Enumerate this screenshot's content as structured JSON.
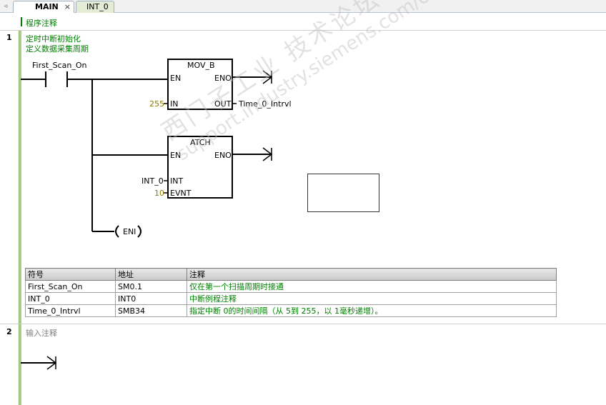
{
  "tabs": [
    {
      "label": "MAIN",
      "close": "×"
    },
    {
      "label": "INT_0"
    }
  ],
  "scroll_left_glyph": "◃",
  "program_comment": "程序注释",
  "network1": {
    "number": "1",
    "comment_line1": "定时中断初始化",
    "comment_line2": "定义数据采集周期",
    "contact_label": "First_Scan_On",
    "mov_b": {
      "title": "MOV_B",
      "en": "EN",
      "eno": "ENO",
      "in": "IN",
      "out": "OUT",
      "in_value": "255",
      "out_value": "Time_0_Intrvl"
    },
    "atch": {
      "title": "ATCH",
      "en": "EN",
      "eno": "ENO",
      "int": "INT",
      "evnt": "EVNT",
      "int_value": "INT_0",
      "evnt_value": "10"
    },
    "eni_coil": "ENI"
  },
  "symbol_table": {
    "headers": [
      "符号",
      "地址",
      "注释"
    ],
    "rows": [
      [
        "First_Scan_On",
        "SM0.1",
        "仅在第一个扫描周期时接通"
      ],
      [
        "INT_0",
        "INT0",
        "中断例程注释"
      ],
      [
        "Time_0_Intrvl",
        "SMB34",
        "指定中断 0的时间间隔（从 5到 255，以 1毫秒递增）。"
      ]
    ]
  },
  "network2": {
    "number": "2",
    "comment_placeholder": "输入注释"
  },
  "watermark": {
    "line1": "西门子工业  技术论坛",
    "line2": "support.industry.siemens.com/cs"
  },
  "colors": {
    "rail_green": "#a8d08a",
    "comment_green": "#008000",
    "value_olive": "#8a7a00"
  }
}
